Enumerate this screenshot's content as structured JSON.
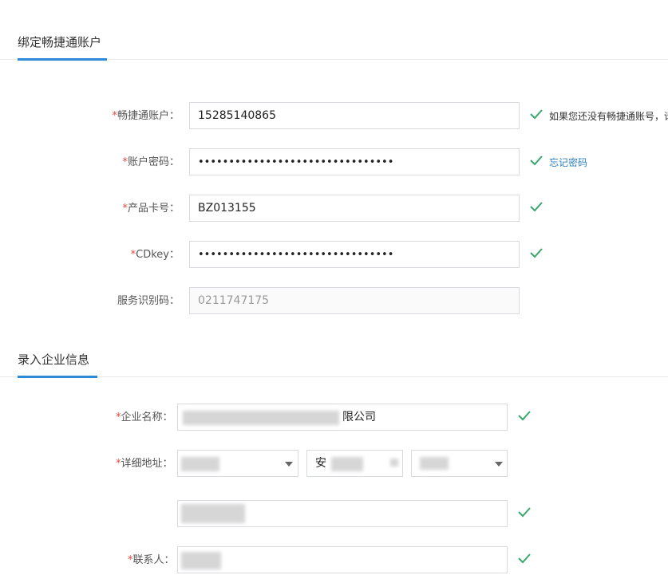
{
  "sections": {
    "bind": {
      "title": "绑定畅捷通账户"
    },
    "company": {
      "title": "录入企业信息"
    }
  },
  "account_form": {
    "account": {
      "label": "畅捷通账户：",
      "value": "15285140865",
      "hint": "如果您还没有畅捷通账号，请"
    },
    "password": {
      "label": "账户密码：",
      "value": "••••••••••••••••••••••••••••••••",
      "link": "忘记密码"
    },
    "card": {
      "label": "产品卡号：",
      "value": "BZ013155"
    },
    "cdkey": {
      "label": "CDkey：",
      "value": "••••••••••••••••••••••••••••••••"
    },
    "service_code": {
      "label": "服务识别码：",
      "value": "0211747175"
    }
  },
  "company_form": {
    "name": {
      "label": "企业名称：",
      "visible_suffix": "限公司"
    },
    "address": {
      "label": "详细地址：",
      "city_partial": "安"
    },
    "contact": {
      "label": "联系人："
    }
  },
  "colors": {
    "accent": "#2f8bd6",
    "required": "#e64a3b",
    "check": "#3aa76d",
    "link": "#2f7fc1"
  },
  "icons": {
    "valid": "check-icon",
    "dropdown": "caret-down-icon"
  }
}
